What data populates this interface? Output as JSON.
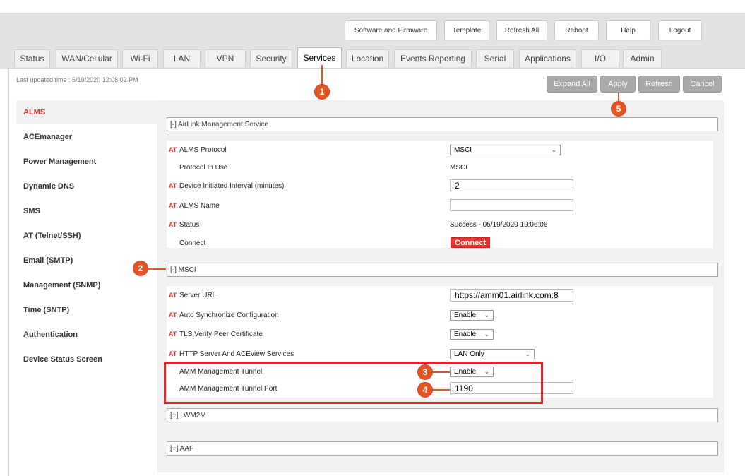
{
  "top_buttons": [
    {
      "label": "Software and Firmware"
    },
    {
      "label": "Template"
    },
    {
      "label": "Refresh All"
    },
    {
      "label": "Reboot"
    },
    {
      "label": "Help"
    },
    {
      "label": "Logout"
    }
  ],
  "tabs": [
    {
      "label": "Status"
    },
    {
      "label": "WAN/Cellular"
    },
    {
      "label": "Wi-Fi"
    },
    {
      "label": "LAN"
    },
    {
      "label": "VPN"
    },
    {
      "label": "Security"
    },
    {
      "label": "Services"
    },
    {
      "label": "Location"
    },
    {
      "label": "Events Reporting"
    },
    {
      "label": "Serial"
    },
    {
      "label": "Applications"
    },
    {
      "label": "I/O"
    },
    {
      "label": "Admin"
    }
  ],
  "active_tab": "Services",
  "last_updated": "Last updated time : 5/19/2020 12:08:02 PM",
  "actions": {
    "expand_all": "Expand All",
    "apply": "Apply",
    "refresh": "Refresh",
    "cancel": "Cancel"
  },
  "nav": [
    {
      "label": "ALMS"
    },
    {
      "label": "ACEmanager"
    },
    {
      "label": "Power Management"
    },
    {
      "label": "Dynamic DNS"
    },
    {
      "label": "SMS"
    },
    {
      "label": "AT (Telnet/SSH)"
    },
    {
      "label": "Email (SMTP)"
    },
    {
      "label": "Management (SNMP)"
    },
    {
      "label": "Time (SNTP)"
    },
    {
      "label": "Authentication"
    },
    {
      "label": "Device Status Screen"
    }
  ],
  "at_tag": "AT",
  "sections": {
    "alms": "[-] AirLink Management Service",
    "msci": "[-] MSCI",
    "lwm2m": "[+] LWM2M",
    "aaf": "[+] AAF"
  },
  "alms_rows": {
    "protocol": {
      "label": "ALMS Protocol",
      "value": "MSCI"
    },
    "protocol_in_use": {
      "label": "Protocol In Use",
      "value": "MSCI"
    },
    "interval": {
      "label": "Device Initiated Interval (minutes)",
      "value": "2"
    },
    "name": {
      "label": "ALMS Name",
      "value": ""
    },
    "status": {
      "label": "Status",
      "value": "Success - 05/19/2020 19:06:06"
    },
    "connect": {
      "label": "Connect",
      "button": "Connect"
    }
  },
  "msci_rows": {
    "server_url": {
      "label": "Server URL",
      "value": "https://amm01.airlink.com:8"
    },
    "auto_sync": {
      "label": "Auto Synchronize Configuration",
      "value": "Enable"
    },
    "tls_verify": {
      "label": "TLS Verify Peer Certificate",
      "value": "Enable"
    },
    "http_server": {
      "label": "HTTP Server And ACEview Services",
      "value": "LAN Only"
    },
    "amm_tunnel": {
      "label": "AMM Management Tunnel",
      "value": "Enable"
    },
    "amm_tunnel_port": {
      "label": "AMM Management Tunnel Port",
      "value": "1190"
    }
  },
  "callouts": [
    "1",
    "2",
    "3",
    "4",
    "5"
  ],
  "colors": {
    "accent_red": "#e3342f",
    "callout_orange": "#e3551f",
    "button_gray": "#a9a9a9"
  }
}
